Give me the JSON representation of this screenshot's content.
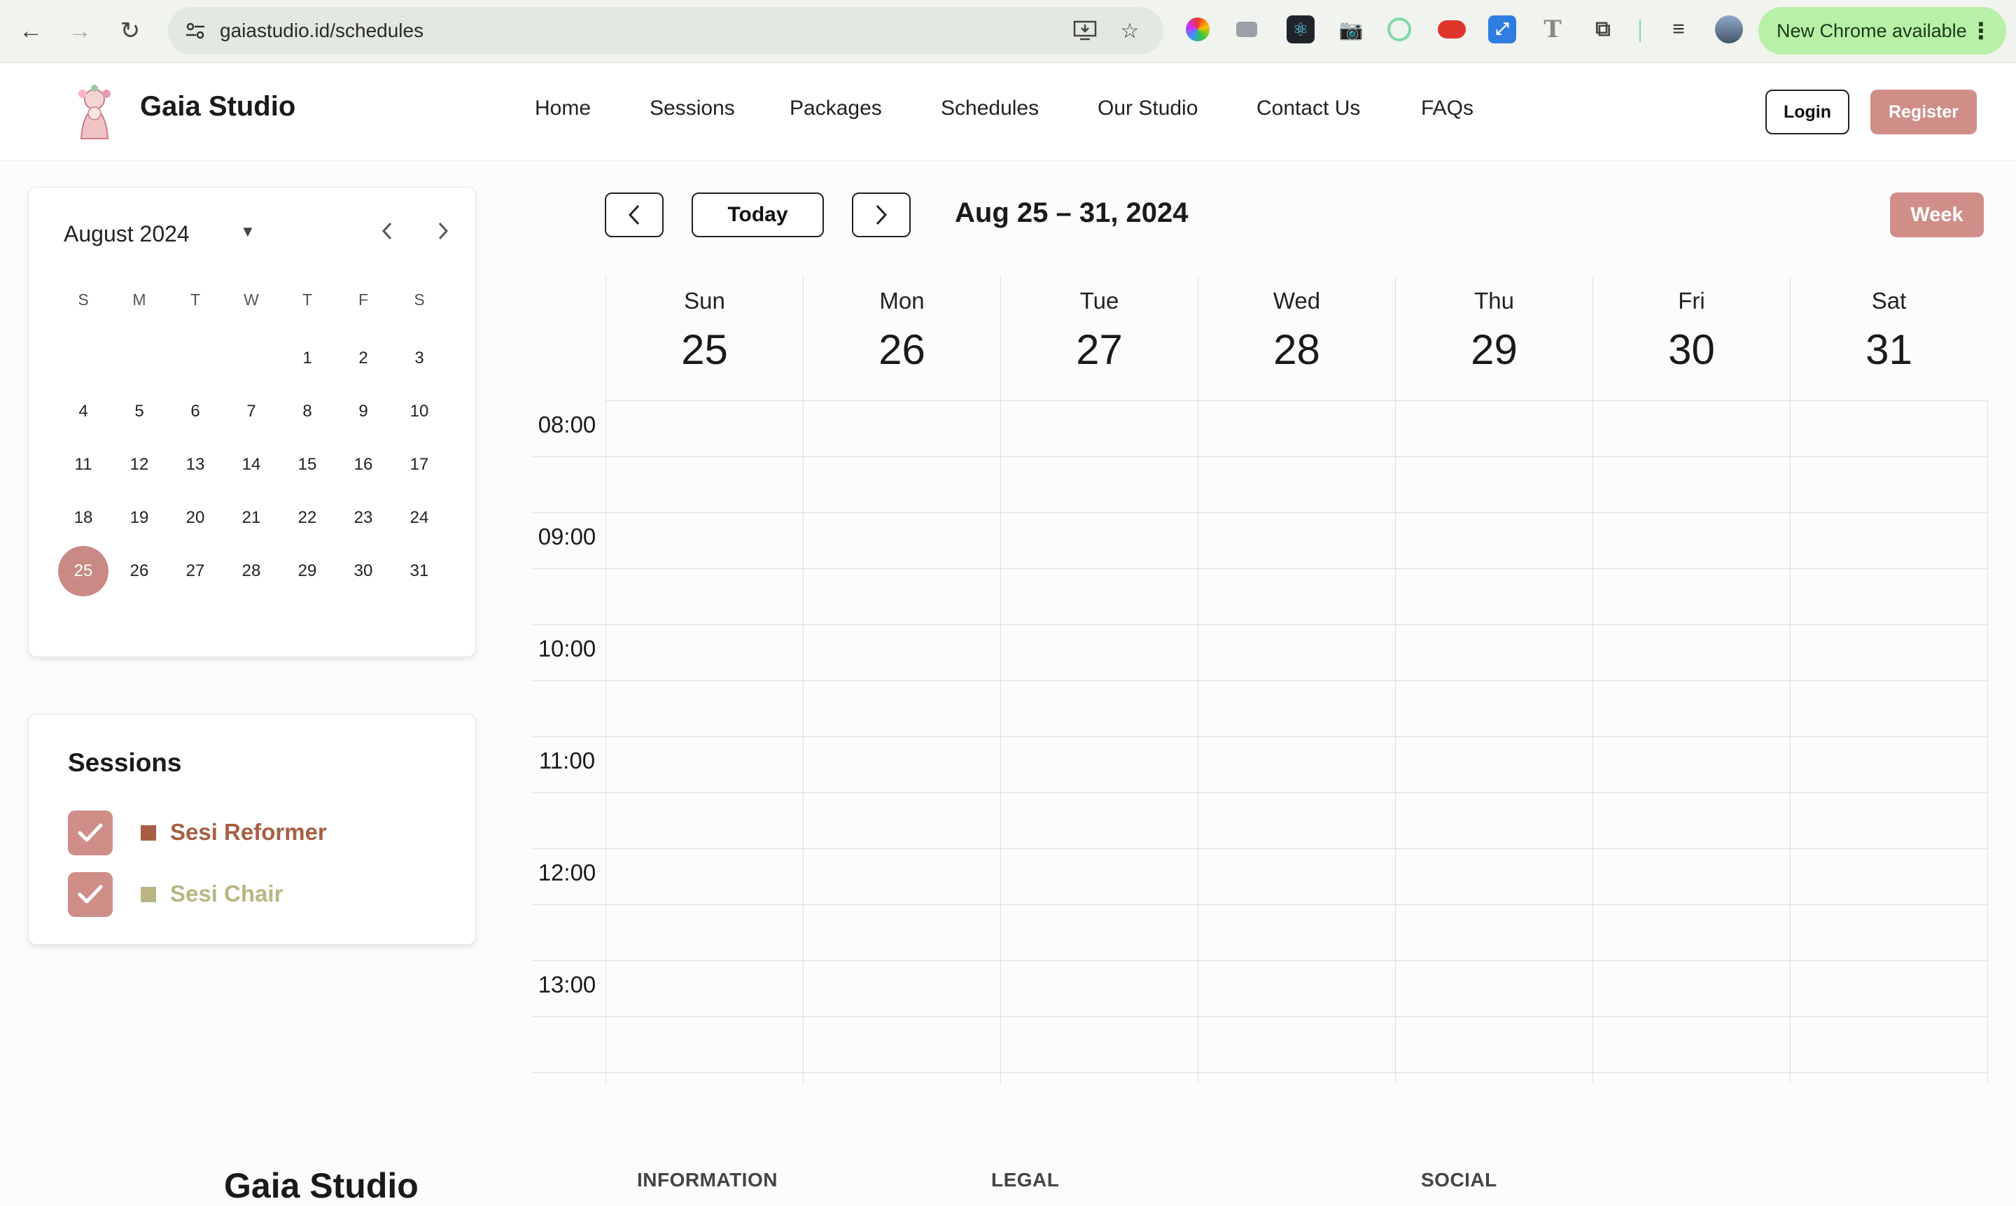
{
  "browser": {
    "url": "gaiastudio.id/schedules",
    "update_label": "New Chrome available",
    "update_menu": "⋮"
  },
  "site": {
    "brand": "Gaia Studio",
    "nav": [
      "Home",
      "Sessions",
      "Packages",
      "Schedules",
      "Our Studio",
      "Contact Us",
      "FAQs"
    ],
    "login_label": "Login",
    "register_label": "Register"
  },
  "mini_calendar": {
    "month_label": "August 2024",
    "weekdays": [
      "S",
      "M",
      "T",
      "W",
      "T",
      "F",
      "S"
    ],
    "leading_blanks": 4,
    "days_in_month": 31,
    "selected_day": 25
  },
  "sessions_panel": {
    "title": "Sessions",
    "items": [
      {
        "label": "Sesi Reformer",
        "color": "#a65f45",
        "checked": true
      },
      {
        "label": "Sesi Chair",
        "color": "#b9b684",
        "checked": true
      }
    ]
  },
  "toolbar": {
    "today_label": "Today",
    "range_title": "Aug 25 – 31, 2024",
    "view_label": "Week"
  },
  "week": {
    "days": [
      {
        "name": "Sun",
        "num": "25"
      },
      {
        "name": "Mon",
        "num": "26"
      },
      {
        "name": "Tue",
        "num": "27"
      },
      {
        "name": "Wed",
        "num": "28"
      },
      {
        "name": "Thu",
        "num": "29"
      },
      {
        "name": "Fri",
        "num": "30"
      },
      {
        "name": "Sat",
        "num": "31"
      }
    ],
    "hours": [
      "08:00",
      "09:00",
      "10:00",
      "11:00",
      "12:00",
      "13:00"
    ]
  },
  "footer": {
    "brand": "Gaia Studio",
    "columns": [
      "INFORMATION",
      "LEGAL",
      "SOCIAL"
    ]
  },
  "colors": {
    "accent": "#d08e88",
    "selected": "#c98a85"
  }
}
